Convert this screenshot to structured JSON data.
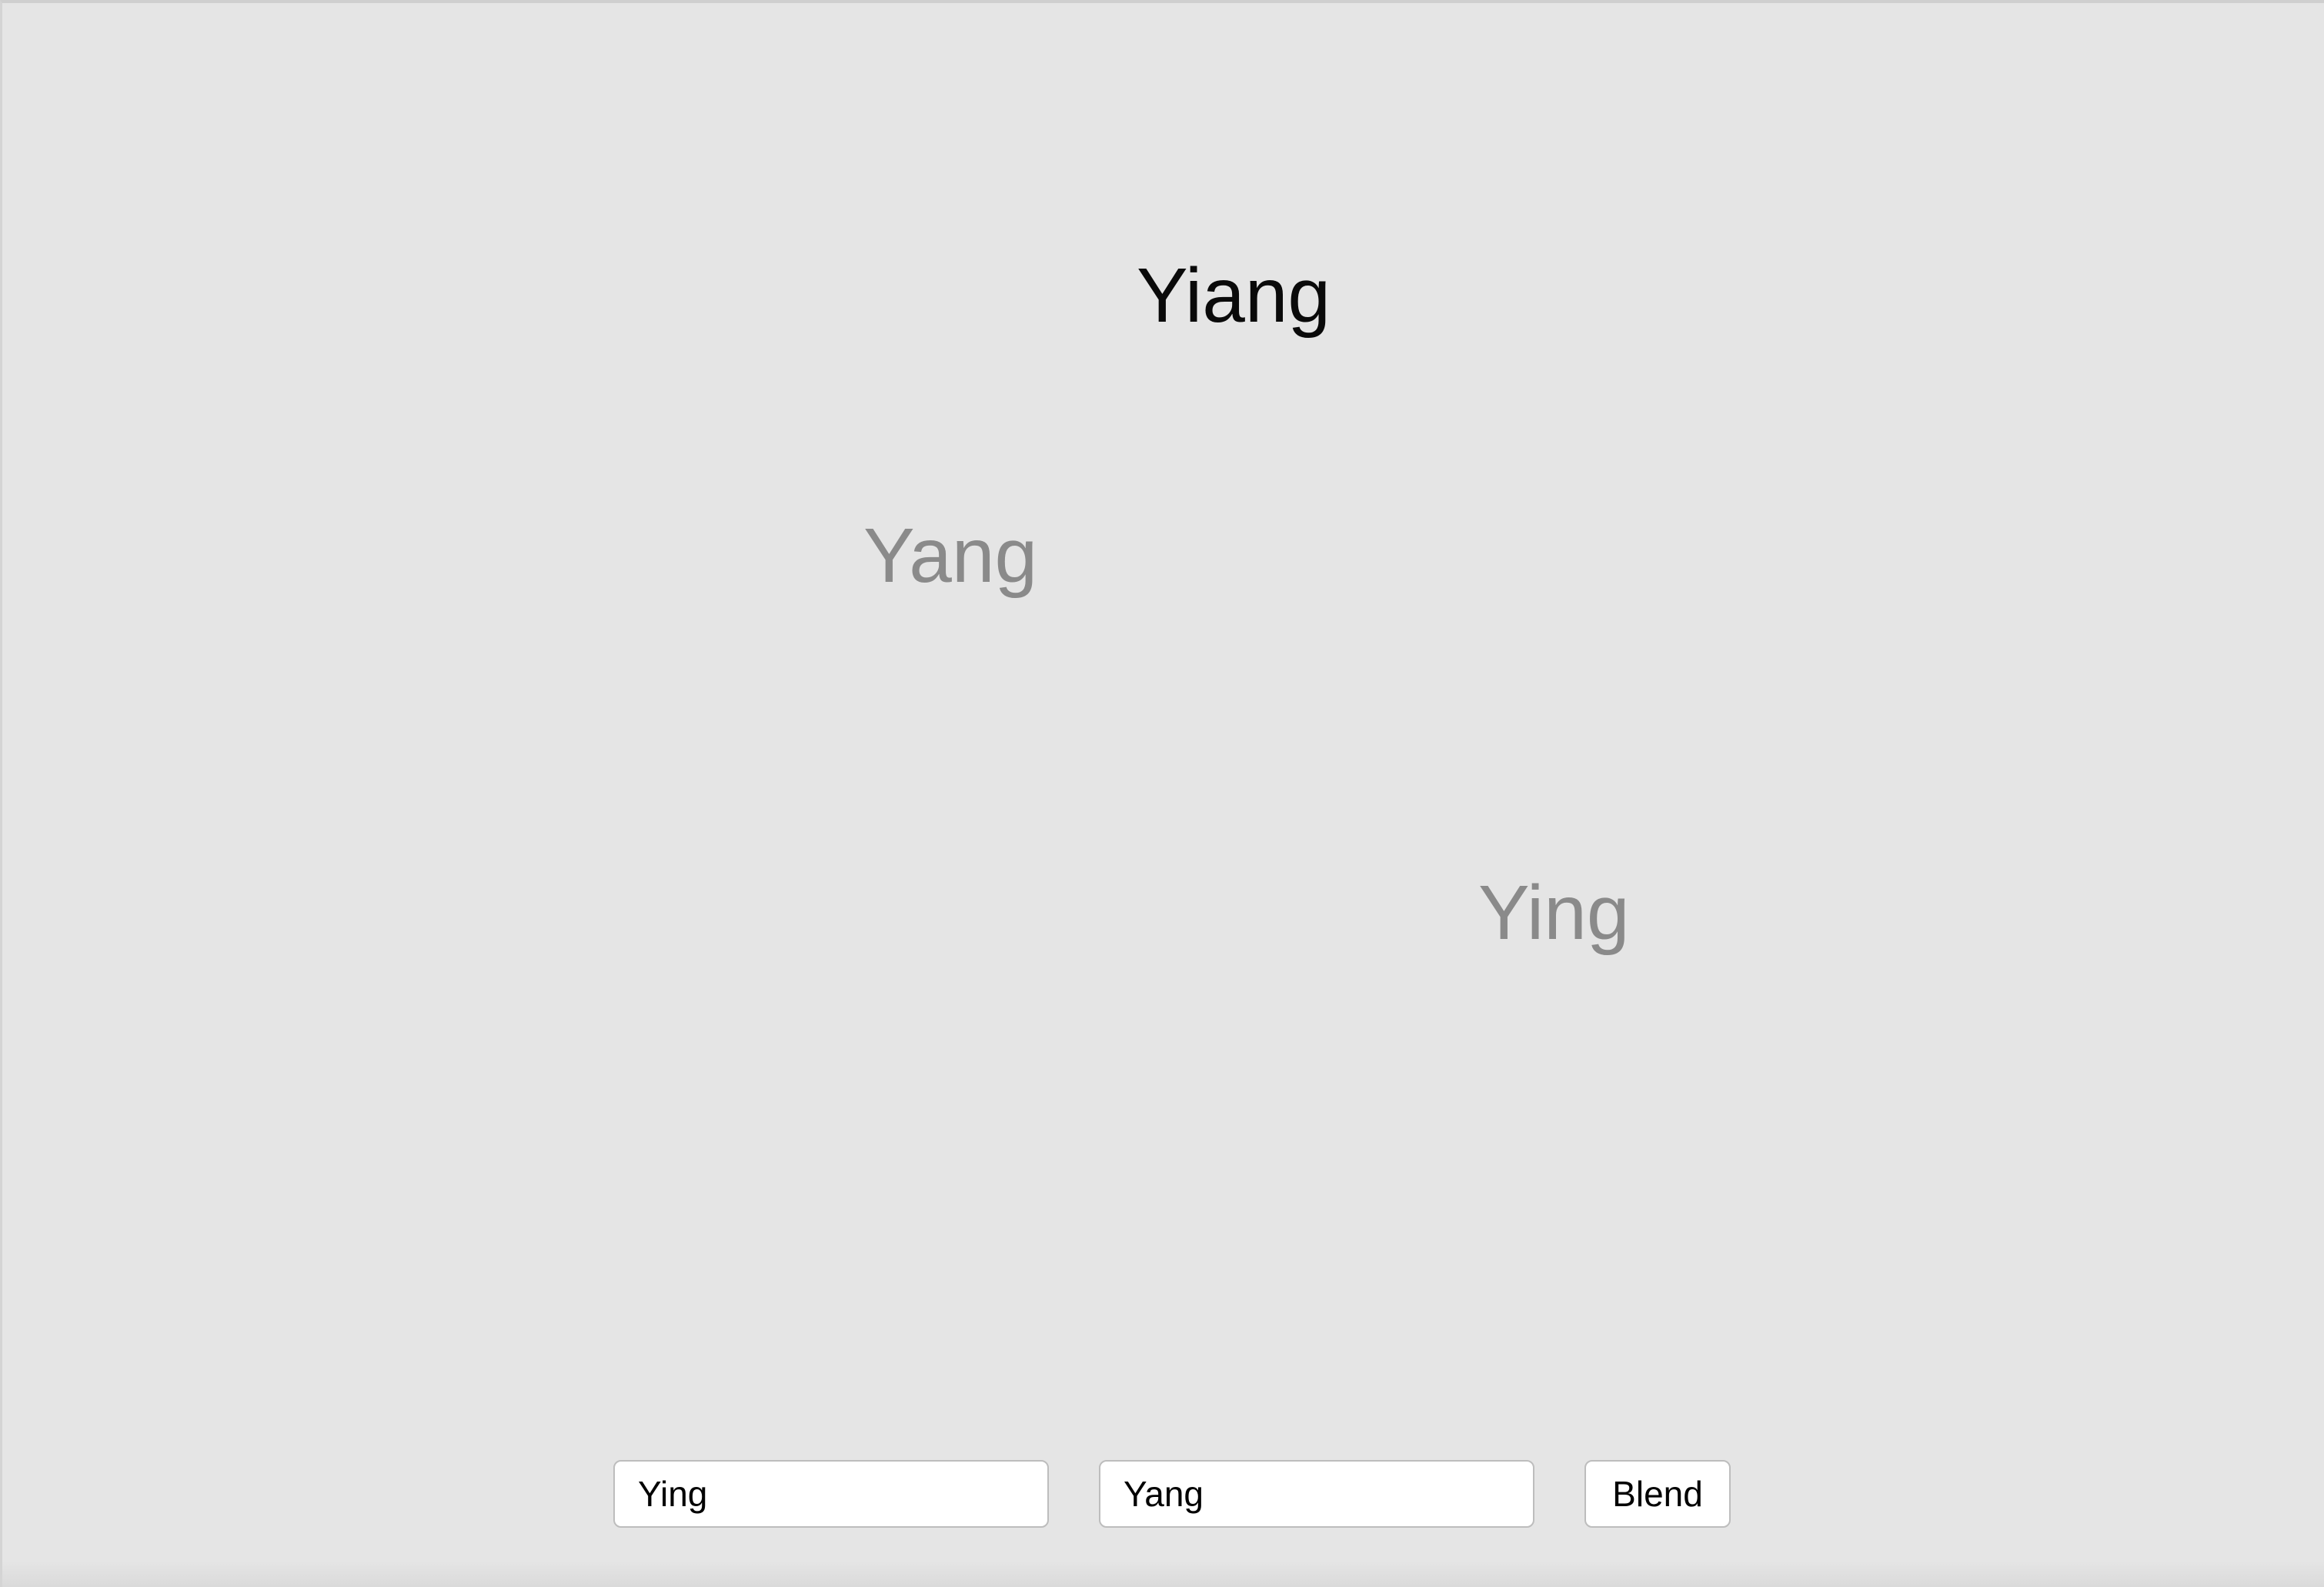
{
  "canvas": {
    "blended_word": "Yiang",
    "source_word_left": "Yang",
    "source_word_right": "Ying"
  },
  "controls": {
    "first_input_value": "Ying",
    "second_input_value": "Yang",
    "blend_label": "Blend"
  },
  "colors": {
    "background": "#e5e5e5",
    "blended_text": "#0a0a0a",
    "source_text": "#8a8a8a"
  }
}
